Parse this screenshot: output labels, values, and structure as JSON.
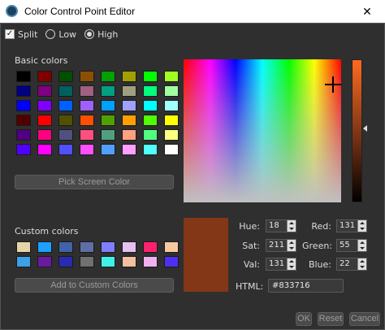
{
  "window": {
    "title": "Color Control Point Editor",
    "close_glyph": "✕"
  },
  "options": {
    "split_label": "Split",
    "split_checked": true,
    "low_label": "Low",
    "high_label": "High",
    "selected_mode": "High"
  },
  "basic_colors": {
    "label": "Basic colors",
    "swatches": [
      "#000000",
      "#800000",
      "#005000",
      "#8a5000",
      "#00a000",
      "#a0a000",
      "#00ff00",
      "#a0ff20",
      "#000080",
      "#800080",
      "#006060",
      "#a06080",
      "#00a080",
      "#a0a080",
      "#00ff80",
      "#a0ffa0",
      "#0000ff",
      "#8000ff",
      "#0060ff",
      "#a060ff",
      "#00a0ff",
      "#a0a0ff",
      "#00ffff",
      "#a0ffff",
      "#500000",
      "#ff0000",
      "#505000",
      "#ff5000",
      "#50a000",
      "#ffa000",
      "#50ff00",
      "#ffff00",
      "#500080",
      "#ff0080",
      "#505080",
      "#ff5080",
      "#50a080",
      "#ffa080",
      "#50ff80",
      "#ffff80",
      "#5000ff",
      "#ff00ff",
      "#5050ff",
      "#ff50ff",
      "#50a0ff",
      "#ffa0ff",
      "#50ffff",
      "#ffffff"
    ]
  },
  "pick_screen_label": "Pick Screen Color",
  "custom_colors": {
    "label": "Custom colors",
    "swatches": [
      "#e6d5a8",
      "#1ea0ff",
      "#3f63a8",
      "#5f6fa4",
      "#7f7fff",
      "#e6c0f0",
      "#ff2070",
      "#f8c8a0",
      "#3ea0e6",
      "#6a1aa0",
      "#2a2ab0",
      "#707070",
      "#40f0e6",
      "#f0c0a0",
      "#f0b0f0",
      "#5030f0"
    ]
  },
  "add_custom_label": "Add to Custom Colors",
  "current_color": "#833716",
  "fields": {
    "hue": {
      "label": "Hue:",
      "value": "18"
    },
    "sat": {
      "label": "Sat:",
      "value": "211"
    },
    "val": {
      "label": "Val:",
      "value": "131"
    },
    "red": {
      "label": "Red:",
      "value": "131"
    },
    "green": {
      "label": "Green:",
      "value": "55"
    },
    "blue": {
      "label": "Blue:",
      "value": "22"
    },
    "html": {
      "label": "HTML:",
      "value": "#833716"
    }
  },
  "buttons": {
    "ok": "OK",
    "reset": "Reset",
    "cancel": "Cancel"
  }
}
